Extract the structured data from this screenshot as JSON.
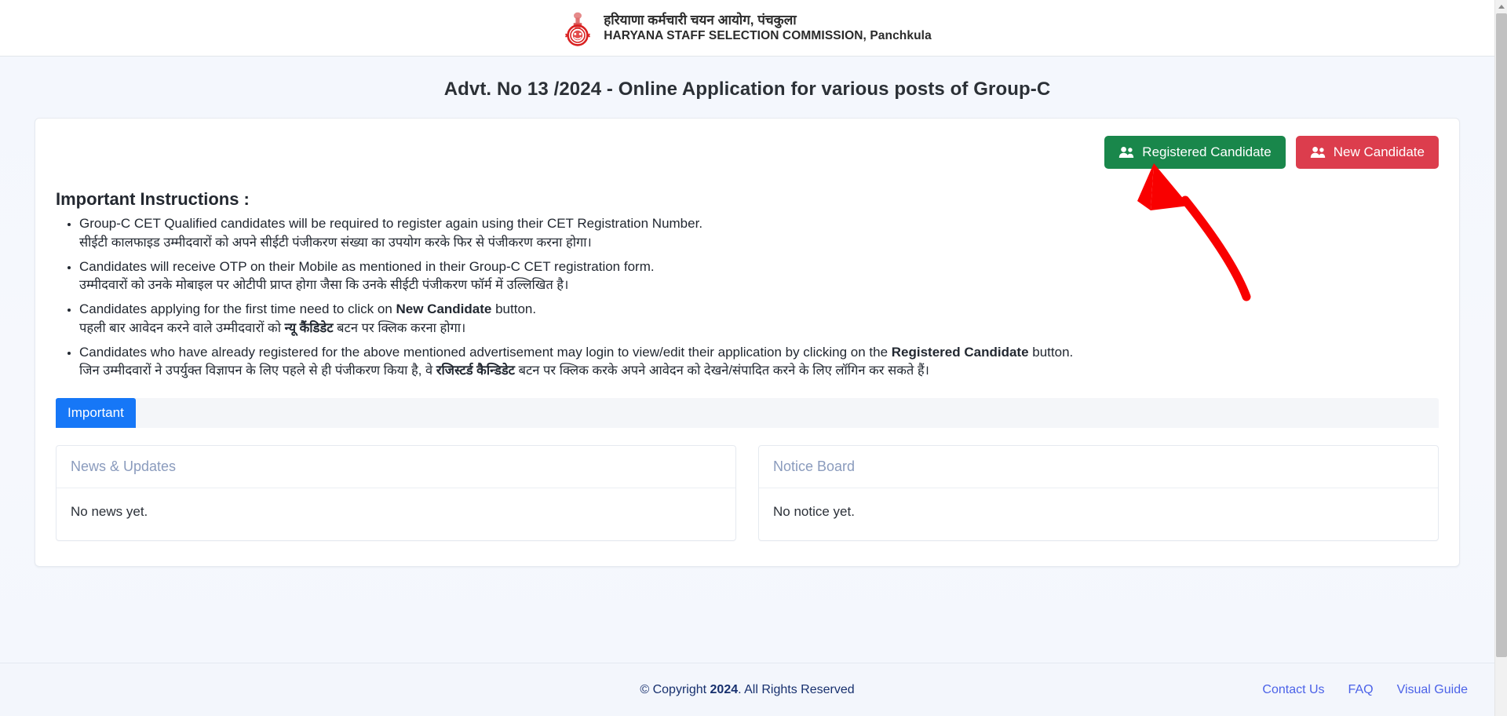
{
  "header": {
    "org_name_hi": "हरियाणा कर्मचारी चयन आयोग, पंचकुला",
    "org_name_en": "HARYANA STAFF SELECTION COMMISSION, Panchkula",
    "emblem_icon": "haryana-state-emblem-icon"
  },
  "page": {
    "title": "Advt. No 13 /2024 - Online Application for various posts of Group-C"
  },
  "actions": {
    "registered_label": "Registered Candidate",
    "new_label": "New Candidate",
    "registered_icon": "users-icon",
    "new_icon": "users-icon",
    "registered_color": "#19874b",
    "new_color": "#dc3d4d"
  },
  "instructions": {
    "heading": "Important Instructions :",
    "items": [
      {
        "en_pre": "Group-C CET Qualified candidates will be required to register again using their CET Registration Number.",
        "en_bold": "",
        "en_post": "",
        "hi_pre": "सीईटी कालफाइड उम्मीदवारों को अपने सीईटी पंजीकरण संख्या का उपयोग करके फिर से पंजीकरण करना होगा।",
        "hi_bold": "",
        "hi_post": ""
      },
      {
        "en_pre": "Candidates will receive OTP on their Mobile as mentioned in their Group-C CET registration form.",
        "en_bold": "",
        "en_post": "",
        "hi_pre": "उम्मीदवारों को उनके मोबाइल पर ओटीपी प्राप्त होगा जैसा कि उनके सीईटी पंजीकरण फॉर्म में उल्लिखित है।",
        "hi_bold": "",
        "hi_post": ""
      },
      {
        "en_pre": "Candidates applying for the first time need to click on ",
        "en_bold": "New Candidate",
        "en_post": " button.",
        "hi_pre": "पहली बार आवेदन करने वाले उम्मीदवारों को ",
        "hi_bold": "न्यू कैंडिडेट",
        "hi_post": " बटन पर क्लिक करना होगा।"
      },
      {
        "en_pre": "Candidates who have already registered for the above mentioned advertisement may login to view/edit their application by clicking on the ",
        "en_bold": "Registered Candidate",
        "en_post": " button.",
        "hi_pre": "जिन उम्मीदवारों ने उपर्युक्त विज्ञापन के लिए पहले से ही पंजीकरण किया है, वे ",
        "hi_bold": "रजिस्टर्ड कैन्डिडेट",
        "hi_post": " बटन पर क्लिक करके अपने आवेदन को देखने/संपादित करने के लिए लॉगिन कर सकते हैं।"
      }
    ]
  },
  "tabs": [
    {
      "label": "Important",
      "active": true,
      "color": "#1677f7"
    }
  ],
  "panels": [
    {
      "title": "News & Updates",
      "body": "No news yet."
    },
    {
      "title": "Notice Board",
      "body": "No notice yet."
    }
  ],
  "annotation": {
    "type": "arrow",
    "color": "#f90000",
    "points_at": "registered-candidate-button"
  },
  "footer": {
    "copyright_pre": "© Copyright ",
    "copyright_year": "2024",
    "copyright_post": ". All Rights Reserved",
    "links": [
      {
        "label": "Contact Us"
      },
      {
        "label": "FAQ"
      },
      {
        "label": "Visual Guide"
      }
    ],
    "link_color": "#4b62e8"
  }
}
